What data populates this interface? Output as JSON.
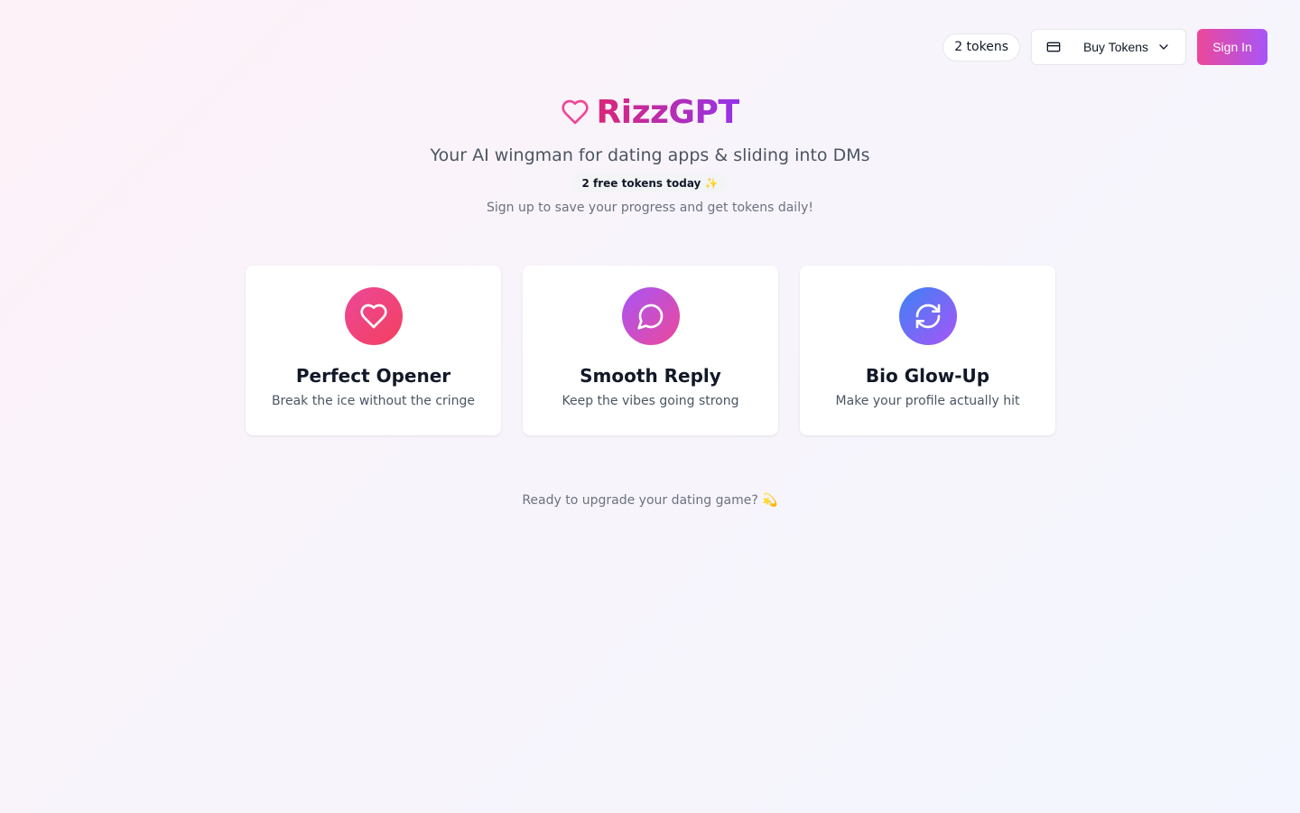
{
  "header": {
    "token_count": "2 tokens",
    "buy_tokens_label": "Buy Tokens",
    "sign_in_label": "Sign In"
  },
  "hero": {
    "brand_name": "RizzGPT",
    "tagline": "Your AI wingman for dating apps & sliding into DMs",
    "free_tokens_badge": "2 free tokens today ✨",
    "signup_note": "Sign up to save your progress and get tokens daily!"
  },
  "features": [
    {
      "title": "Perfect Opener",
      "description": "Break the ice without the cringe",
      "icon": "heart-icon"
    },
    {
      "title": "Smooth Reply",
      "description": "Keep the vibes going strong",
      "icon": "message-circle-icon"
    },
    {
      "title": "Bio Glow-Up",
      "description": "Make your profile actually hit",
      "icon": "refresh-icon"
    }
  ],
  "footer": {
    "note": "Ready to upgrade your dating game? 💫"
  },
  "colors": {
    "brand_pink": "#ec4899",
    "brand_purple": "#a855f7",
    "brand_blue": "#3b82f6"
  }
}
